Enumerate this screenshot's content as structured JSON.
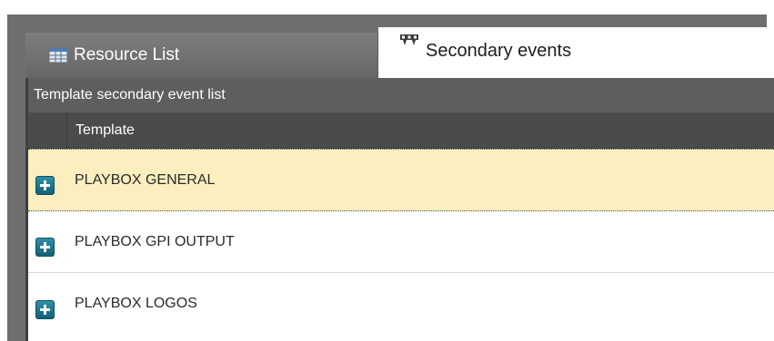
{
  "tabs": [
    {
      "label": "Resource List",
      "icon": "grid-table-icon",
      "active": false
    },
    {
      "label": "Secondary events",
      "icon": "secondary-events-icon",
      "active": true
    }
  ],
  "panel": {
    "title": "Template secondary event list",
    "column_header": "Template"
  },
  "rows": [
    {
      "label": "PLAYBOX GENERAL",
      "selected": true
    },
    {
      "label": "PLAYBOX GPI OUTPUT",
      "selected": false
    },
    {
      "label": "PLAYBOX LOGOS",
      "selected": false
    }
  ],
  "colors": {
    "selected_row": "#fcefbf",
    "expand_button": "#1b6f87",
    "header": "#5e5e5e"
  }
}
